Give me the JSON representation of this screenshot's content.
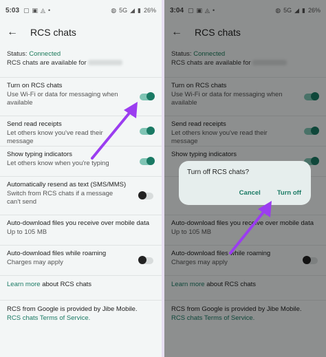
{
  "colors": {
    "accent": "#1a7a64",
    "arrow": "#9b3df0",
    "background": "#f3f6f6"
  },
  "left": {
    "status": {
      "time": "5:03",
      "network": "5G",
      "battery": "26%"
    },
    "appbar": {
      "title": "RCS chats"
    },
    "rcs": {
      "status_label": "Status:",
      "status_value": "Connected",
      "available_text": "RCS chats are available for"
    },
    "settings": [
      {
        "title": "Turn on RCS chats",
        "subtitle": "Use Wi-Fi or data for messaging when available",
        "on": true
      },
      {
        "title": "Send read receipts",
        "subtitle": "Let others know you've read their message",
        "on": true
      },
      {
        "title": "Show typing indicators",
        "subtitle": "Let others know when you're typing",
        "on": true
      },
      {
        "title": "Automatically resend as text (SMS/MMS)",
        "subtitle": "Switch from RCS chats if a message can't send",
        "on": false
      },
      {
        "title": "Auto-download files you receive over mobile data",
        "subtitle": "Up to 105 MB"
      },
      {
        "title": "Auto-download files while roaming",
        "subtitle": "Charges may apply",
        "on": false
      }
    ],
    "footer": {
      "learn_link": "Learn more",
      "learn_text": "about RCS chats",
      "provider": "RCS from Google is provided by Jibe Mobile.",
      "tos": "RCS chats Terms of Service."
    }
  },
  "right": {
    "status": {
      "time": "3:04",
      "network": "5G",
      "battery": "26%"
    },
    "appbar": {
      "title": "RCS chats"
    },
    "rcs": {
      "status_label": "Status:",
      "status_value": "Connected",
      "available_text": "RCS chats are available for"
    },
    "settings": [
      {
        "title": "Turn on RCS chats",
        "subtitle": "Use Wi-Fi or data for messaging when available",
        "on": true
      },
      {
        "title": "Send read receipts",
        "subtitle": "Let others know you've read their message",
        "on": true
      },
      {
        "title": "Show typing indicators",
        "subtitle": "",
        "on": true
      },
      {
        "title": "",
        "subtitle": ""
      },
      {
        "title": "Auto-download files you receive over mobile data",
        "subtitle": "Up to 105 MB"
      },
      {
        "title": "Auto-download files while roaming",
        "subtitle": "Charges may apply",
        "on": false
      }
    ],
    "footer": {
      "learn_link": "Learn more",
      "learn_text": "about RCS chats",
      "provider": "RCS from Google is provided by Jibe Mobile.",
      "tos": "RCS chats Terms of Service."
    },
    "dialog": {
      "title": "Turn off RCS chats?",
      "cancel": "Cancel",
      "confirm": "Turn off"
    }
  }
}
